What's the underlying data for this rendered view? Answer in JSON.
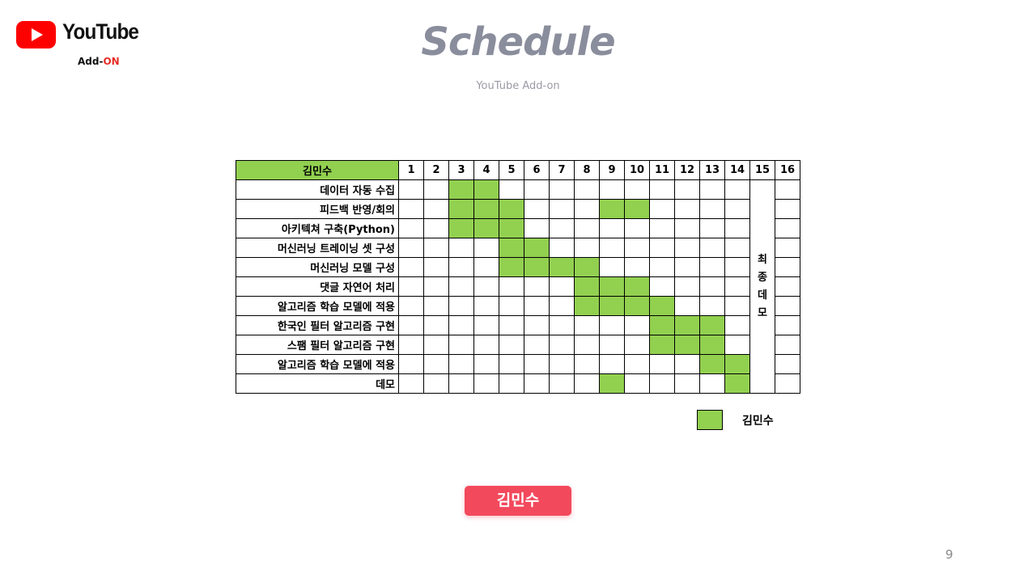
{
  "brand": {
    "wordmark": "YouTube",
    "sub_prefix": "Add-",
    "sub_accent": "ON",
    "red": "#ff0000"
  },
  "header": {
    "title": "Schedule",
    "subtitle": "YouTube Add-on"
  },
  "schedule": {
    "owner_header": "김민수",
    "weeks": [
      "1",
      "2",
      "3",
      "4",
      "5",
      "6",
      "7",
      "8",
      "9",
      "10",
      "11",
      "12",
      "13",
      "14",
      "15",
      "16"
    ],
    "final_week": 15,
    "final_label": [
      "최",
      "종",
      "데",
      "모"
    ],
    "fill_color": "#92d050",
    "tasks": [
      {
        "name": "데이터 자동 수집",
        "weeks": [
          3,
          4
        ]
      },
      {
        "name": "피드백 반영/회의",
        "weeks": [
          3,
          4,
          5,
          9,
          10
        ]
      },
      {
        "name": "아키텍쳐 구축(Python)",
        "weeks": [
          3,
          4,
          5
        ]
      },
      {
        "name": "머신러닝 트레이닝 셋 구성",
        "weeks": [
          5,
          6
        ]
      },
      {
        "name": "머신러닝 모델  구성",
        "weeks": [
          5,
          6,
          7,
          8
        ]
      },
      {
        "name": "댓글 자연어 처리",
        "weeks": [
          8,
          9,
          10
        ]
      },
      {
        "name": "알고리즘 학습 모델에 적용",
        "weeks": [
          8,
          9,
          10,
          11
        ]
      },
      {
        "name": "한국인 필터 알고리즘 구현",
        "weeks": [
          11,
          12,
          13
        ]
      },
      {
        "name": "스팸 필터 알고리즘 구현",
        "weeks": [
          11,
          12,
          13
        ]
      },
      {
        "name": "알고리즘 학습 모델에 적용",
        "weeks": [
          13,
          14
        ]
      },
      {
        "name": "데모",
        "weeks": [
          9,
          14
        ]
      }
    ]
  },
  "legend": {
    "label": "김민수"
  },
  "footer": {
    "person_button": "김민수",
    "page_number": "9"
  }
}
